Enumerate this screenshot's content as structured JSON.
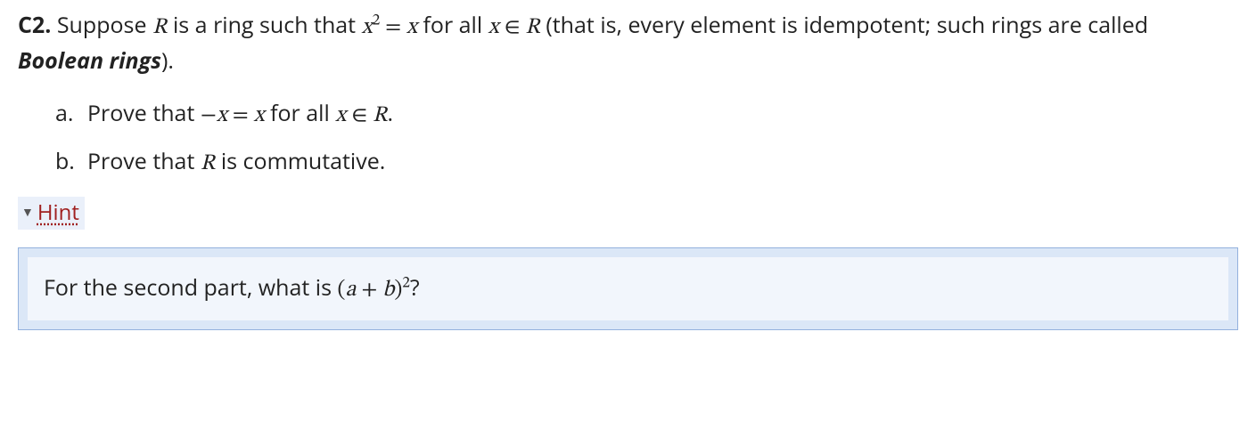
{
  "problem": {
    "label": "C2.",
    "intro_part1": " Suppose ",
    "intro_part2": " is a ring such that ",
    "intro_part3": " for all ",
    "intro_part4": " (that is, every element is idempotent; such rings are called ",
    "bold_term": "Boolean rings",
    "intro_part5": ")."
  },
  "sub_items": {
    "a": {
      "marker": "a.",
      "text_part1": "Prove that ",
      "text_part2": " for all ",
      "text_part3": "."
    },
    "b": {
      "marker": "b.",
      "text_part1": "Prove that ",
      "text_part2": " is commutative."
    }
  },
  "hint": {
    "toggle_label": "Hint",
    "content_part1": "For the second part, what is ",
    "content_part2": "?"
  },
  "math": {
    "R": "R",
    "x": "x",
    "a": "a",
    "b": "b",
    "eq": " = ",
    "minus": "−",
    "plus": " + ",
    "in": " ∈ ",
    "lparen": "(",
    "rparen": ")",
    "sup2": "2"
  }
}
